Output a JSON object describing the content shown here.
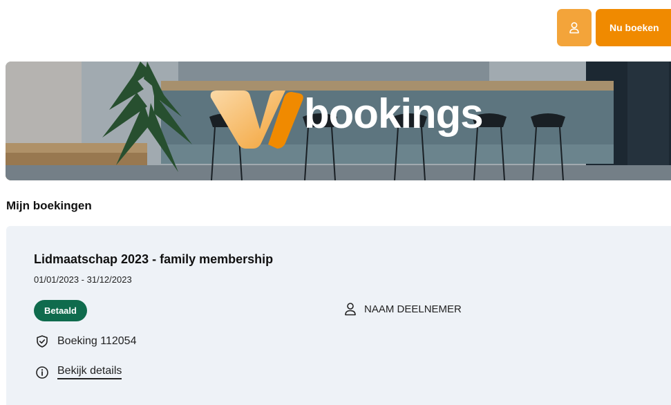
{
  "colors": {
    "accent": "#f08a00",
    "accent_light": "#f3a43a",
    "status_green": "#0f6b4d",
    "card_bg": "#eef2f7"
  },
  "header": {
    "user_icon": "user-icon",
    "book_button_label": "Nu boeken"
  },
  "banner": {
    "logo_text": "bookings"
  },
  "section": {
    "title": "Mijn boekingen"
  },
  "booking": {
    "title": "Lidmaatschap 2023 - family membership",
    "dates": "01/01/2023 - 31/12/2023",
    "status": "Betaald",
    "participant": "NAAM DEELNEMER",
    "participant_icon": "user-icon",
    "booking_label": "Boeking 112054",
    "booking_icon": "shield-check-icon",
    "details_label": "Bekijk details",
    "details_icon": "info-icon"
  }
}
